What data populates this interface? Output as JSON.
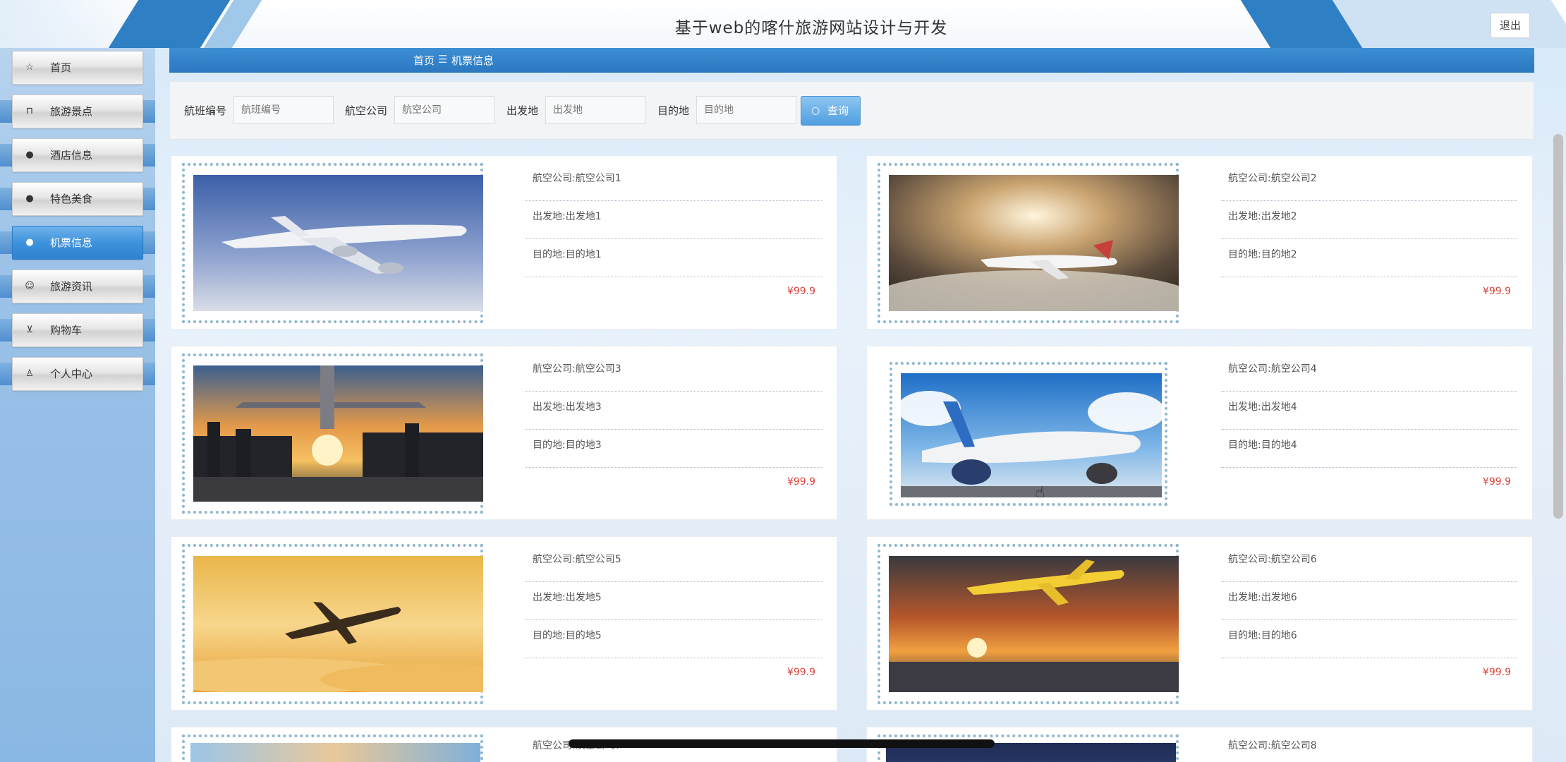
{
  "header": {
    "title": "基于web的喀什旅游网站设计与开发",
    "logout_label": "退出"
  },
  "sidebar": {
    "items": [
      {
        "label": "首页",
        "icon": "star-icon",
        "active": false
      },
      {
        "label": "旅游景点",
        "icon": "bag-icon",
        "active": false
      },
      {
        "label": "酒店信息",
        "icon": "info-circle-icon",
        "active": false
      },
      {
        "label": "特色美食",
        "icon": "question-circle-icon",
        "active": false
      },
      {
        "label": "机票信息",
        "icon": "info-circle-icon",
        "active": true
      },
      {
        "label": "旅游资讯",
        "icon": "smile-icon",
        "active": false
      },
      {
        "label": "购物车",
        "icon": "cart-icon",
        "active": false
      },
      {
        "label": "个人中心",
        "icon": "user-icon",
        "active": false
      }
    ]
  },
  "breadcrumb": {
    "home": "首页",
    "separator": "☰",
    "current": "机票信息"
  },
  "search": {
    "flight_no_label": "航班编号",
    "flight_no_placeholder": "航班编号",
    "airline_label": "航空公司",
    "airline_placeholder": "航空公司",
    "origin_label": "出发地",
    "origin_placeholder": "出发地",
    "dest_label": "目的地",
    "dest_placeholder": "目的地",
    "button_label": "查询"
  },
  "flights": [
    {
      "airline": "航空公司:航空公司1",
      "origin": "出发地:出发地1",
      "dest": "目的地:目的地1",
      "price": "¥99.9",
      "photo": "plane-blue-sky"
    },
    {
      "airline": "航空公司:航空公司2",
      "origin": "出发地:出发地2",
      "dest": "目的地:目的地2",
      "price": "¥99.9",
      "photo": "plane-clouds-sunlight"
    },
    {
      "airline": "航空公司:航空公司3",
      "origin": "出发地:出发地3",
      "dest": "目的地:目的地3",
      "price": "¥99.9",
      "photo": "plane-city-sunset"
    },
    {
      "airline": "航空公司:航空公司4",
      "origin": "出发地:出发地4",
      "dest": "目的地:目的地4",
      "price": "¥99.9",
      "photo": "plane-on-runway"
    },
    {
      "airline": "航空公司:航空公司5",
      "origin": "出发地:出发地5",
      "dest": "目的地:目的地5",
      "price": "¥99.9",
      "photo": "plane-golden-sky"
    },
    {
      "airline": "航空公司:航空公司6",
      "origin": "出发地:出发地6",
      "dest": "目的地:目的地6",
      "price": "¥99.9",
      "photo": "plane-sea-sunset"
    }
  ],
  "partial_flights": [
    {
      "airline": "航空公司:航空公司7"
    },
    {
      "airline": "航空公司:航空公司8"
    }
  ],
  "colors": {
    "primary": "#2b78c0",
    "active_nav": "#3e92dc",
    "price": "#d9443b"
  }
}
